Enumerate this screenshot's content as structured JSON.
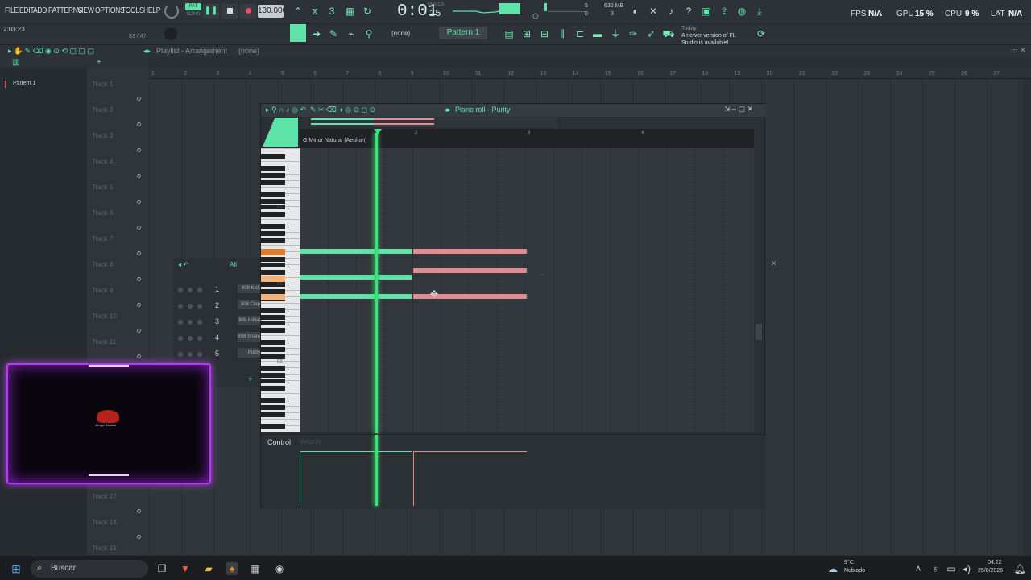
{
  "menu": {
    "file": "FILE",
    "edit": "EDIT",
    "add": "ADD",
    "patterns": "PATTERNS",
    "view": "VIEW",
    "options": "OPTIONS",
    "tools": "TOOLS",
    "help": "HELP"
  },
  "transport": {
    "pat_label": "PAT",
    "song_label": "SONG",
    "tempo": "130.000",
    "time": "0:01",
    "time_sub": "25",
    "time_mode": "M:S:CS"
  },
  "hint": {
    "position": "2:03:23",
    "count": "83 / 47"
  },
  "monitor": {
    "cpu_count": "5",
    "mem": "630 MB",
    "voices": "3",
    "voices_zero": "0"
  },
  "news": {
    "day": "Today",
    "text": "A newer version of FL Studio is available!"
  },
  "stats": {
    "fps_label": "FPS",
    "fps": "N/A",
    "gpu_label": "GPU",
    "gpu": "15 %",
    "cpu_label": "CPU",
    "cpu": "9 %",
    "lat_label": "LAT",
    "lat": "N/A"
  },
  "toolbar2": {
    "none_label": "(none)",
    "pattern": "Pattern 1"
  },
  "playlist": {
    "title": "Playlist - Arrangement",
    "none": "(none)",
    "pattern_item": "Pattern 1"
  },
  "tracks": [
    "Track 1",
    "Track 2",
    "Track 3",
    "Track 4",
    "Track 5",
    "Track 6",
    "Track 7",
    "Track 8",
    "Track 9",
    "Track 10",
    "Track 11",
    "Track 17",
    "Track 18",
    "Track 19"
  ],
  "ruler": [
    "1",
    "2",
    "3",
    "4",
    "5",
    "6",
    "7",
    "8",
    "9",
    "10",
    "11",
    "12",
    "13",
    "14",
    "15",
    "16",
    "17",
    "18",
    "19",
    "20",
    "21",
    "22",
    "23",
    "24",
    "25",
    "26",
    "27"
  ],
  "piano_roll": {
    "title": "Piano roll - Purity",
    "scale": "G Minor Natural (Aeolian)",
    "bar2": "2",
    "bar3": "3",
    "bar4": "4",
    "c5": "C5",
    "c4": "C4",
    "c3": "C3",
    "control": "Control",
    "velocity": "Velocity"
  },
  "channels": {
    "filter": "All",
    "items": [
      {
        "num": "1",
        "name": "808 Kick"
      },
      {
        "num": "2",
        "name": "808 Clap"
      },
      {
        "num": "3",
        "name": "808 HiHat"
      },
      {
        "num": "4",
        "name": "808 Snare"
      },
      {
        "num": "5",
        "name": "Purity"
      }
    ]
  },
  "overlay": {
    "brand": "Jungle Studios"
  },
  "taskbar": {
    "search": "Buscar",
    "weather_temp": "9°C",
    "weather_desc": "Nublado",
    "time": "04:22",
    "date": "25/8/2026"
  }
}
